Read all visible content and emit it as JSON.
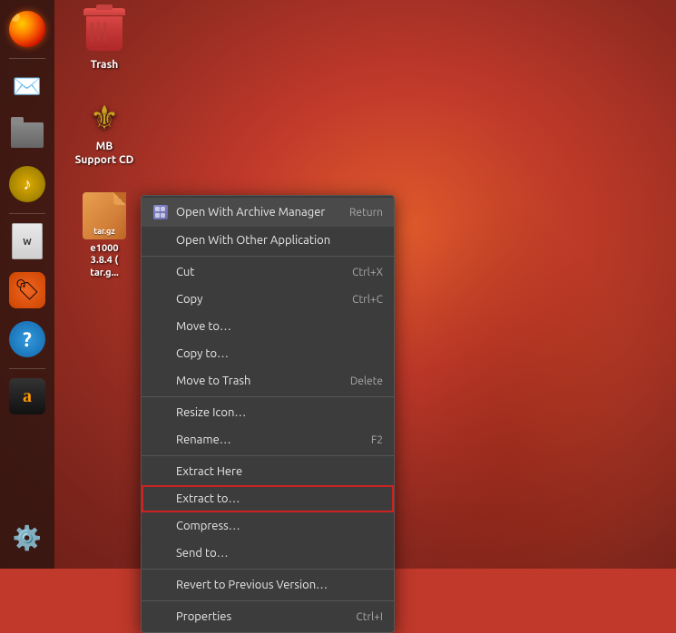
{
  "desktop": {
    "background_colors": [
      "#e05a2b",
      "#c0392b",
      "#7b241c"
    ],
    "icons": [
      {
        "id": "trash",
        "label": "Trash",
        "type": "trash"
      },
      {
        "id": "mb-support-cd",
        "label": "MB\nSupport CD",
        "label_line1": "MB",
        "label_line2": "Support CD",
        "type": "mb"
      },
      {
        "id": "tar-file",
        "label": "e1000\n3.8.4 (\ntar.g...",
        "label_line1": "e1000",
        "label_line2": "3.8.4 (",
        "label_line3": "tar.g...",
        "type": "file"
      }
    ]
  },
  "taskbar": {
    "icons": [
      {
        "id": "firefox",
        "label": "Firefox Web Browser",
        "icon": "🦊"
      },
      {
        "id": "email",
        "label": "Thunderbird Mail",
        "icon": "✉"
      },
      {
        "id": "files",
        "label": "Files",
        "icon": "🗄"
      },
      {
        "id": "music",
        "label": "Rhythmbox",
        "icon": "🎵"
      },
      {
        "id": "writer",
        "label": "LibreOffice Writer",
        "icon": "📝"
      },
      {
        "id": "software",
        "label": "Ubuntu Software",
        "icon": "🏷"
      },
      {
        "id": "help",
        "label": "Help",
        "icon": "❓"
      },
      {
        "id": "amazon",
        "label": "Amazon",
        "icon": "🅰"
      },
      {
        "id": "settings",
        "label": "System Settings",
        "icon": "⚙"
      }
    ]
  },
  "context_menu": {
    "items": [
      {
        "id": "open-archive",
        "label": "Open With Archive Manager",
        "shortcut": "Return",
        "icon": "archive",
        "first": true
      },
      {
        "id": "open-other",
        "label": "Open With Other Application",
        "shortcut": "",
        "icon": ""
      },
      {
        "id": "separator1",
        "type": "separator"
      },
      {
        "id": "cut",
        "label": "Cut",
        "shortcut": "Ctrl+X",
        "icon": ""
      },
      {
        "id": "copy",
        "label": "Copy",
        "shortcut": "Ctrl+C",
        "icon": ""
      },
      {
        "id": "move-to",
        "label": "Move to…",
        "shortcut": "",
        "icon": ""
      },
      {
        "id": "copy-to",
        "label": "Copy to…",
        "shortcut": "",
        "icon": ""
      },
      {
        "id": "move-to-trash",
        "label": "Move to Trash",
        "shortcut": "Delete",
        "icon": ""
      },
      {
        "id": "separator2",
        "type": "separator"
      },
      {
        "id": "resize-icon",
        "label": "Resize Icon…",
        "shortcut": "",
        "icon": ""
      },
      {
        "id": "rename",
        "label": "Rename…",
        "shortcut": "F2",
        "icon": ""
      },
      {
        "id": "separator3",
        "type": "separator"
      },
      {
        "id": "extract-here",
        "label": "Extract Here",
        "shortcut": "",
        "icon": ""
      },
      {
        "id": "extract-to",
        "label": "Extract to…",
        "shortcut": "",
        "icon": "",
        "highlighted": true
      },
      {
        "id": "compress",
        "label": "Compress…",
        "shortcut": "",
        "icon": ""
      },
      {
        "id": "send-to",
        "label": "Send to…",
        "shortcut": "",
        "icon": ""
      },
      {
        "id": "separator4",
        "type": "separator"
      },
      {
        "id": "revert",
        "label": "Revert to Previous Version…",
        "shortcut": "",
        "icon": ""
      },
      {
        "id": "separator5",
        "type": "separator"
      },
      {
        "id": "properties",
        "label": "Properties",
        "shortcut": "Ctrl+I",
        "icon": ""
      }
    ]
  }
}
